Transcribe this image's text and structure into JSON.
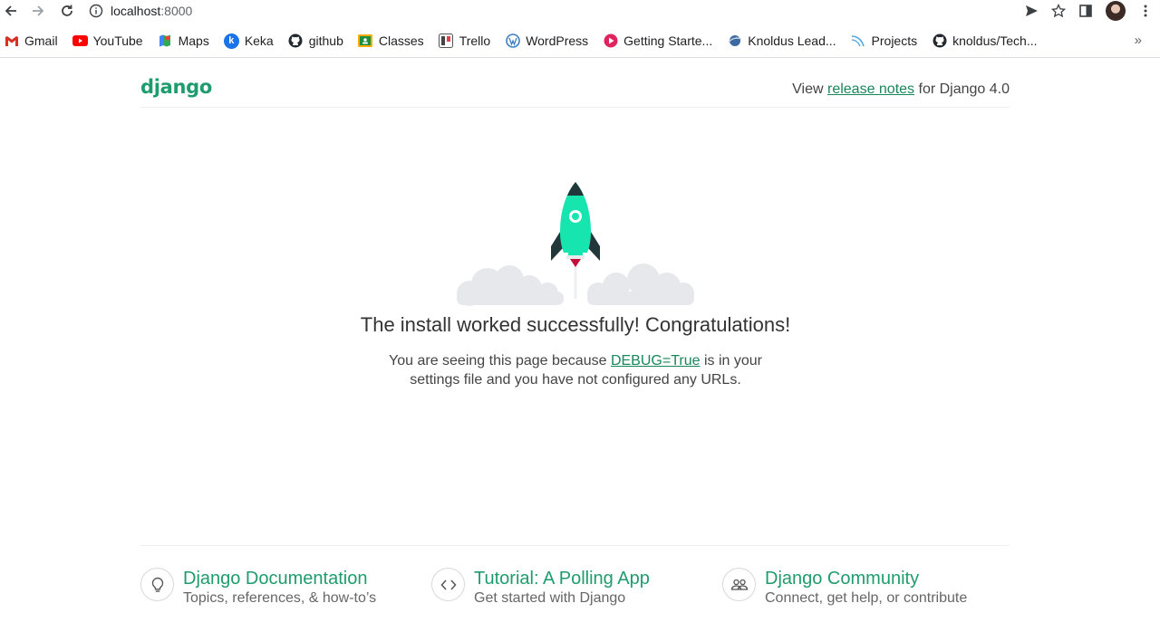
{
  "browser": {
    "url_host": "localhost",
    "url_port": ":8000",
    "bookmarks": [
      {
        "label": "Gmail",
        "icon": "gmail-icon"
      },
      {
        "label": "YouTube",
        "icon": "youtube-icon"
      },
      {
        "label": "Maps",
        "icon": "maps-icon"
      },
      {
        "label": "Keka",
        "icon": "keka-icon"
      },
      {
        "label": "github",
        "icon": "github-icon"
      },
      {
        "label": "Classes",
        "icon": "classes-icon"
      },
      {
        "label": "Trello",
        "icon": "trello-icon"
      },
      {
        "label": "WordPress",
        "icon": "wordpress-icon"
      },
      {
        "label": "Getting Starte...",
        "icon": "getting-started-icon"
      },
      {
        "label": "Knoldus Lead...",
        "icon": "knoldus-icon"
      },
      {
        "label": "Projects",
        "icon": "projects-icon"
      },
      {
        "label": "knoldus/Tech...",
        "icon": "github-icon"
      }
    ],
    "more_label": "»"
  },
  "page": {
    "logo": "django",
    "release": {
      "prefix": "View ",
      "link": "release notes",
      "suffix": " for Django 4.0"
    },
    "title": "The install worked successfully! Congratulations!",
    "subtitle": {
      "part1": "You are seeing this page because ",
      "link": "DEBUG=True",
      "part2": " is in your settings file and you have not configured any URLs."
    },
    "cards": [
      {
        "title": "Django Documentation",
        "subtitle": "Topics, references, & how-to’s",
        "icon": "lightbulb-icon"
      },
      {
        "title": "Tutorial: A Polling App",
        "subtitle": "Get started with Django",
        "icon": "code-icon"
      },
      {
        "title": "Django Community",
        "subtitle": "Connect, get help, or contribute",
        "icon": "people-icon"
      }
    ]
  },
  "colors": {
    "accent": "#1f9c6e",
    "rocket": "#17e5b0",
    "link": "#19865c"
  }
}
